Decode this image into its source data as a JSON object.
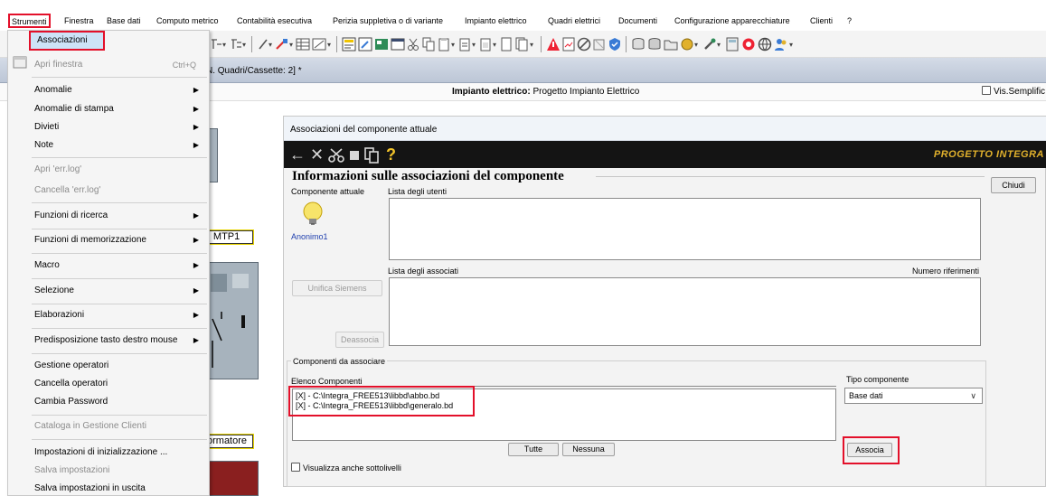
{
  "menubar": {
    "items": [
      "Strumenti",
      "Finestra",
      "Base dati",
      "Computo metrico",
      "Contabilità esecutiva",
      "Perizia suppletiva o di variante",
      "Impianto elettrico",
      "Quadri elettrici",
      "Documenti",
      "Configurazione apparecchiature",
      "Clienti",
      "?"
    ]
  },
  "doc": {
    "title": "N. Quadri/Cassette: 2] *",
    "impianto_label": "Impianto elettrico:",
    "impianto_value": "Progetto Impianto Elettrico",
    "vis_semplificata": "Vis.Semplific"
  },
  "canvas": {
    "label_mtp": "| MTP1",
    "label_trasf": "ormatore"
  },
  "menu": {
    "items": [
      {
        "label": "Associazioni",
        "state": "highlighted"
      },
      {
        "label": "Apri finestra",
        "shortcut": "Ctrl+Q",
        "state": "disabled"
      },
      {
        "label": "Anomalie",
        "submenu": true
      },
      {
        "label": "Anomalie di stampa",
        "submenu": true
      },
      {
        "label": "Divieti",
        "submenu": true
      },
      {
        "label": "Note",
        "submenu": true
      },
      {
        "label": "Apri 'err.log'",
        "state": "disabled"
      },
      {
        "label": "Cancella 'err.log'",
        "state": "disabled"
      },
      {
        "label": "Funzioni di ricerca",
        "submenu": true
      },
      {
        "label": "Funzioni di memorizzazione",
        "submenu": true
      },
      {
        "label": "Macro",
        "submenu": true
      },
      {
        "label": "Selezione",
        "submenu": true
      },
      {
        "label": "Elaborazioni",
        "submenu": true
      },
      {
        "label": "Predisposizione tasto destro mouse",
        "submenu": true
      },
      {
        "label": "Gestione operatori"
      },
      {
        "label": "Cancella operatori"
      },
      {
        "label": "Cambia Password"
      },
      {
        "label": "Cataloga in Gestione Clienti",
        "state": "disabled"
      },
      {
        "label": "Impostazioni di inizializzazione ..."
      },
      {
        "label": "Salva impostazioni",
        "state": "disabled"
      },
      {
        "label": "Salva impostazioni in uscita"
      }
    ],
    "submenu_arrow": "▶"
  },
  "panel": {
    "title": "Associazioni del componente attuale",
    "logo": "PROGETTO INTEGRA",
    "section_title": "Informazioni sulle associazioni del componente",
    "componente_attuale": "Componente attuale",
    "lista_utenti": "Lista degli utenti",
    "component_name": "Anonimo1",
    "lista_associati": "Lista degli associati",
    "numero_riferimenti": "Numero riferimenti",
    "unifica_siemens": "Unifica Siemens",
    "deassocia": "Deassocia",
    "chiudi": "Chiudi",
    "componenti_da_associare": "Componenti da associare",
    "elenco_componenti": "Elenco Componenti",
    "list_items": [
      "[X] - C:\\Integra_FREE513\\libbd\\abbo.bd",
      "[X] - C:\\Integra_FREE513\\libbd\\generalo.bd"
    ],
    "tutte": "Tutte",
    "nessuna": "Nessuna",
    "tipo_componente": "Tipo componente",
    "tipo_value": "Base dati",
    "associa": "Associa",
    "visualizza_sottolivelli": "Visualizza anche sottolivelli"
  },
  "icons": {
    "back": "arrow-left-icon",
    "close": "x-icon",
    "cut": "scissors-icon",
    "doc": "document-icon",
    "copy": "copy-icon",
    "help": "question-icon",
    "bulb": "lightbulb-icon"
  }
}
